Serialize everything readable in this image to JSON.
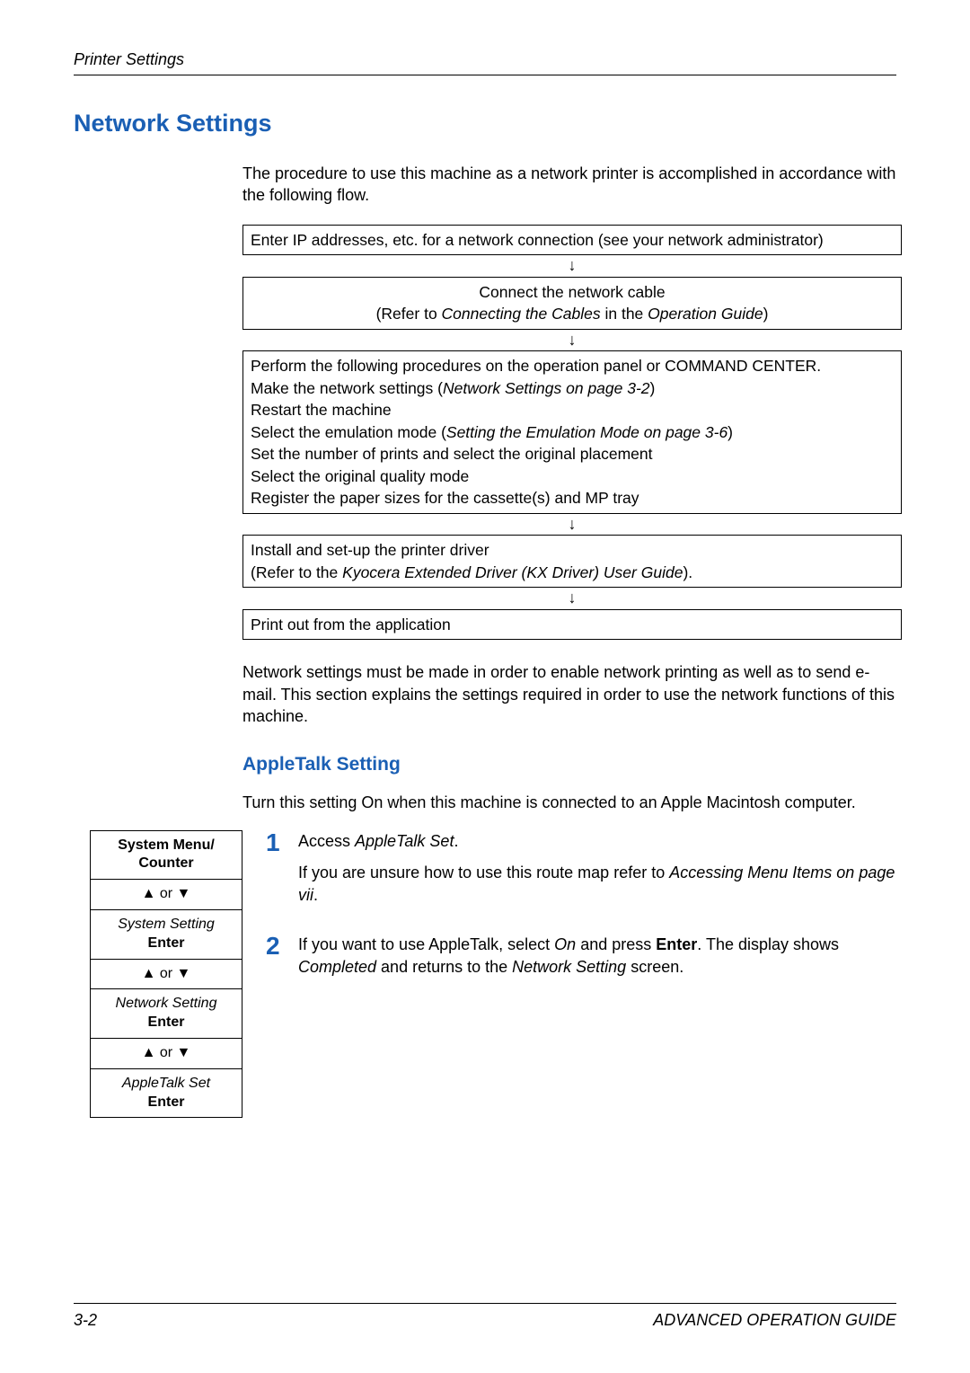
{
  "header": "Printer Settings",
  "h1": "Network Settings",
  "intro": "The procedure to use this machine as a network printer is accomplished in accordance with the following flow.",
  "flow": {
    "box1": "Enter IP addresses, etc. for a network connection (see your network administrator)",
    "box2_l1": "Connect the network cable",
    "box2_l2a": "(Refer to ",
    "box2_l2b": "Connecting the Cables",
    "box2_l2c": " in the ",
    "box2_l2d": "Operation Guide",
    "box2_l2e": ")",
    "box3_l1": "Perform the following procedures on the operation panel or COMMAND CENTER.",
    "box3_l2a": "Make the network settings (",
    "box3_l2b": "Network Settings on page 3-2",
    "box3_l2c": ")",
    "box3_l3": "Restart the machine",
    "box3_l4a": "Select the emulation mode (",
    "box3_l4b": "Setting the Emulation Mode on page 3-6",
    "box3_l4c": ")",
    "box3_l5": "Set the number of prints and select the original placement",
    "box3_l6": "Select the original quality mode",
    "box3_l7": "Register the paper sizes for the cassette(s) and MP tray",
    "box4_l1": "Install and set-up the printer driver",
    "box4_l2a": "(Refer to the ",
    "box4_l2b": "Kyocera Extended Driver (KX Driver) User Guide",
    "box4_l2c": ").",
    "box5": "Print out from the application"
  },
  "arrow": "↓",
  "para2": "Network settings must be made in order to enable network printing as well as to send e-mail. This section explains the settings required in order to use the network functions of this machine.",
  "h2": "AppleTalk Setting",
  "para3": "Turn this setting On when this machine is connected to an Apple Macintosh computer.",
  "route": {
    "c1a": "System Menu/",
    "c1b": "Counter",
    "nav": "▲ or ▼",
    "c2a": "System Setting",
    "enter": "Enter",
    "c3a": "Network Setting",
    "c4a": "AppleTalk Set"
  },
  "steps": {
    "n1": "1",
    "s1a": "Access ",
    "s1b": "AppleTalk Set",
    "s1c": ".",
    "s1d": "If you are unsure how to use this route map refer to ",
    "s1e": "Accessing Menu Items on page vii",
    "s1f": ".",
    "n2": "2",
    "s2a": "If you want to use AppleTalk, select ",
    "s2b": "On",
    "s2c": " and press ",
    "s2d": "Enter",
    "s2e": ". The display shows ",
    "s2f": "Completed",
    "s2g": " and returns to the ",
    "s2h": "Network Setting",
    "s2i": " screen."
  },
  "footer": {
    "left": "3-2",
    "right": "ADVANCED OPERATION GUIDE"
  }
}
